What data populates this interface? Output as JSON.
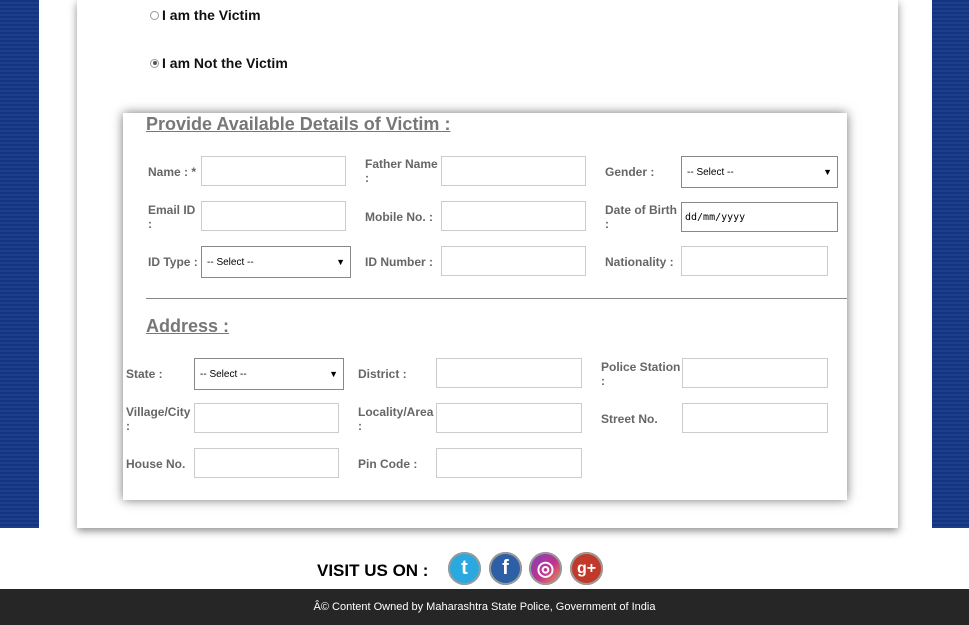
{
  "victim_choice": {
    "option_victim": "I am the Victim",
    "option_not_victim": "I am Not the Victim",
    "selected": "not_victim"
  },
  "victim_details": {
    "title": "Provide Available Details of Victim :",
    "name_label_1": "Name : *",
    "father_name_label_1": "Father Name",
    "father_name_label_2": ":",
    "gender_label": "Gender :",
    "gender_value": "-- Select --",
    "email_label_1": "Email ID",
    "email_label_2": ":",
    "mobile_label": "Mobile No. :",
    "dob_label_1": "Date of Birth",
    "dob_label_2": ":",
    "dob_placeholder": "dd/mm/yyyy",
    "id_type_label": "ID Type :",
    "id_type_value": "-- Select --",
    "id_number_label": "ID Number :",
    "nationality_label": "Nationality :"
  },
  "address": {
    "title": "Address :",
    "state_label": "State :",
    "state_value": "-- Select --",
    "district_label": "District :",
    "police_station_label_1": "Police Station",
    "police_station_label_2": ":",
    "village_label_1": "Village/City",
    "village_label_2": ":",
    "locality_label_1": "Locality/Area",
    "locality_label_2": ":",
    "street_label": "Street No.",
    "house_label": "House No.",
    "pin_label": "Pin Code :"
  },
  "social": {
    "label": "VISIT US ON :",
    "icons": [
      "twitter-icon",
      "facebook-icon",
      "instagram-icon",
      "google-plus-icon"
    ],
    "twitter_glyph": "t",
    "facebook_glyph": "f",
    "instagram_glyph": "◎",
    "google_glyph": "g+",
    "colors": {
      "twitter": "#2aa9e0",
      "facebook": "#2d5fa6",
      "instagram": "#c1338f",
      "google": "#c0392b"
    }
  },
  "footer": {
    "text": "Â© Content Owned by Maharashtra State Police, Government of India"
  }
}
